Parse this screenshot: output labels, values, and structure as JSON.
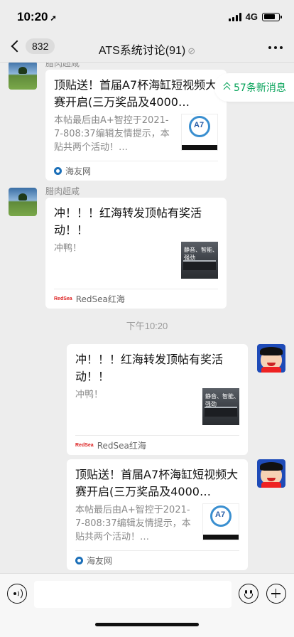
{
  "status_bar": {
    "time": "10:20",
    "location_arrow": "➚",
    "network": "4G",
    "battery_level": 0.75
  },
  "header": {
    "back_count": "832",
    "title": "ATS系统讨论(91)",
    "mute_icon": "mute-bell-icon",
    "more_icon": "more-dots-icon"
  },
  "new_messages": {
    "label": "57条新消息"
  },
  "messages": [
    {
      "sender": "腊肉超咸",
      "direction": "incoming",
      "card": {
        "title": "顶贴送！首届A7杯海缸短视频大赛开启(三万奖品及4000…",
        "description": "本帖最后由A+智控于2021-7-808:37编辑友情提示，本贴共两个活动！…",
        "source": "海友网",
        "thumb": "haiyou",
        "thumb_text": "A7"
      }
    },
    {
      "sender": "腊肉超咸",
      "direction": "incoming",
      "card": {
        "title": "冲！！！红海转发顶帖有奖活动！！",
        "description": "冲鸭！",
        "source": "RedSea红海",
        "source_logo": "RedSea",
        "thumb": "redsea",
        "thumb_text": "静音、智能、强劲"
      }
    },
    {
      "timestamp": "下午10:20"
    },
    {
      "direction": "outgoing",
      "card": {
        "title": "冲！！！红海转发顶帖有奖活动！！",
        "description": "冲鸭！",
        "source": "RedSea红海",
        "source_logo": "RedSea",
        "thumb": "redsea",
        "thumb_text": "静音、智能、强劲"
      }
    },
    {
      "direction": "outgoing",
      "card": {
        "title": "顶贴送！首届A7杯海缸短视频大赛开启(三万奖品及4000…",
        "description": "本帖最后由A+智控于2021-7-808:37编辑友情提示，本贴共两个活动！…",
        "source": "海友网",
        "thumb": "haiyou",
        "thumb_text": "A7"
      }
    }
  ],
  "input_bar": {
    "value": ""
  }
}
